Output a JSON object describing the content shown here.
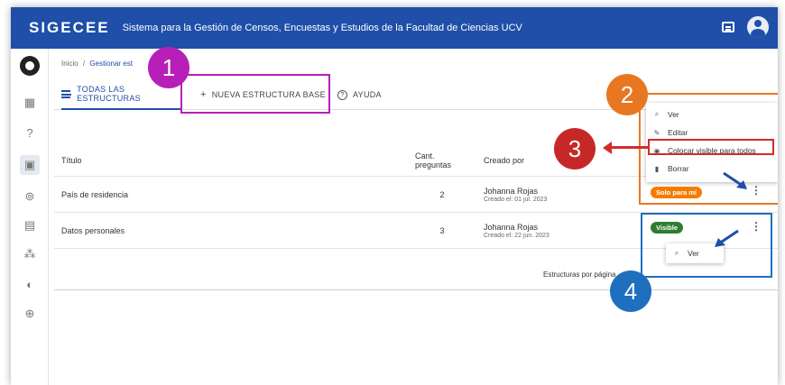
{
  "header": {
    "brand": "SIGECEE",
    "app_title": "Sistema para la Gestión de Censos, Encuestas y Estudios de la Facultad de Ciencias UCV",
    "bg_color": "#1f4fa8"
  },
  "breadcrumb": {
    "home": "Inicio",
    "separator": "/",
    "current": "Gestionar est"
  },
  "tabs": [
    {
      "label": "TODAS LAS ESTRUCTURAS",
      "icon": "list-icon"
    },
    {
      "label": "NUEVA ESTRUCTURA BASE",
      "icon": "plus-icon"
    },
    {
      "label": "AYUDA",
      "icon": "help-icon"
    }
  ],
  "table": {
    "headers": [
      "Título",
      "Cant. preguntas",
      "Creado por"
    ],
    "rows": [
      {
        "title": "País de residencia",
        "count": "2",
        "creator": "Johanna Rojas",
        "created": "Creado el: 01 jul. 2023",
        "status": "Solo para mí",
        "status_color": "#f57c00"
      },
      {
        "title": "Datos personales",
        "count": "3",
        "creator": "Johanna Rojas",
        "created": "Creado el: 22 jun. 2023",
        "status": "Visible",
        "status_color": "#2e7d32"
      }
    ],
    "footer": "Estructuras por página"
  },
  "menu_owner": {
    "items": [
      {
        "label": "Ver",
        "icon": "search-icon"
      },
      {
        "label": "Editar",
        "icon": "pencil-icon"
      },
      {
        "label": "Colocar visible para todos",
        "icon": "eye-icon"
      },
      {
        "label": "Borrar",
        "icon": "trash-icon"
      }
    ]
  },
  "menu_visible": {
    "items": [
      {
        "label": "Ver",
        "icon": "search-icon"
      }
    ]
  },
  "annotations": {
    "n1": "1",
    "n2": "2",
    "n3": "3",
    "n4": "4",
    "color1": "#b81fb8",
    "color2": "#e87722",
    "color3": "#d32b2b",
    "color4": "#1f6fbf"
  }
}
